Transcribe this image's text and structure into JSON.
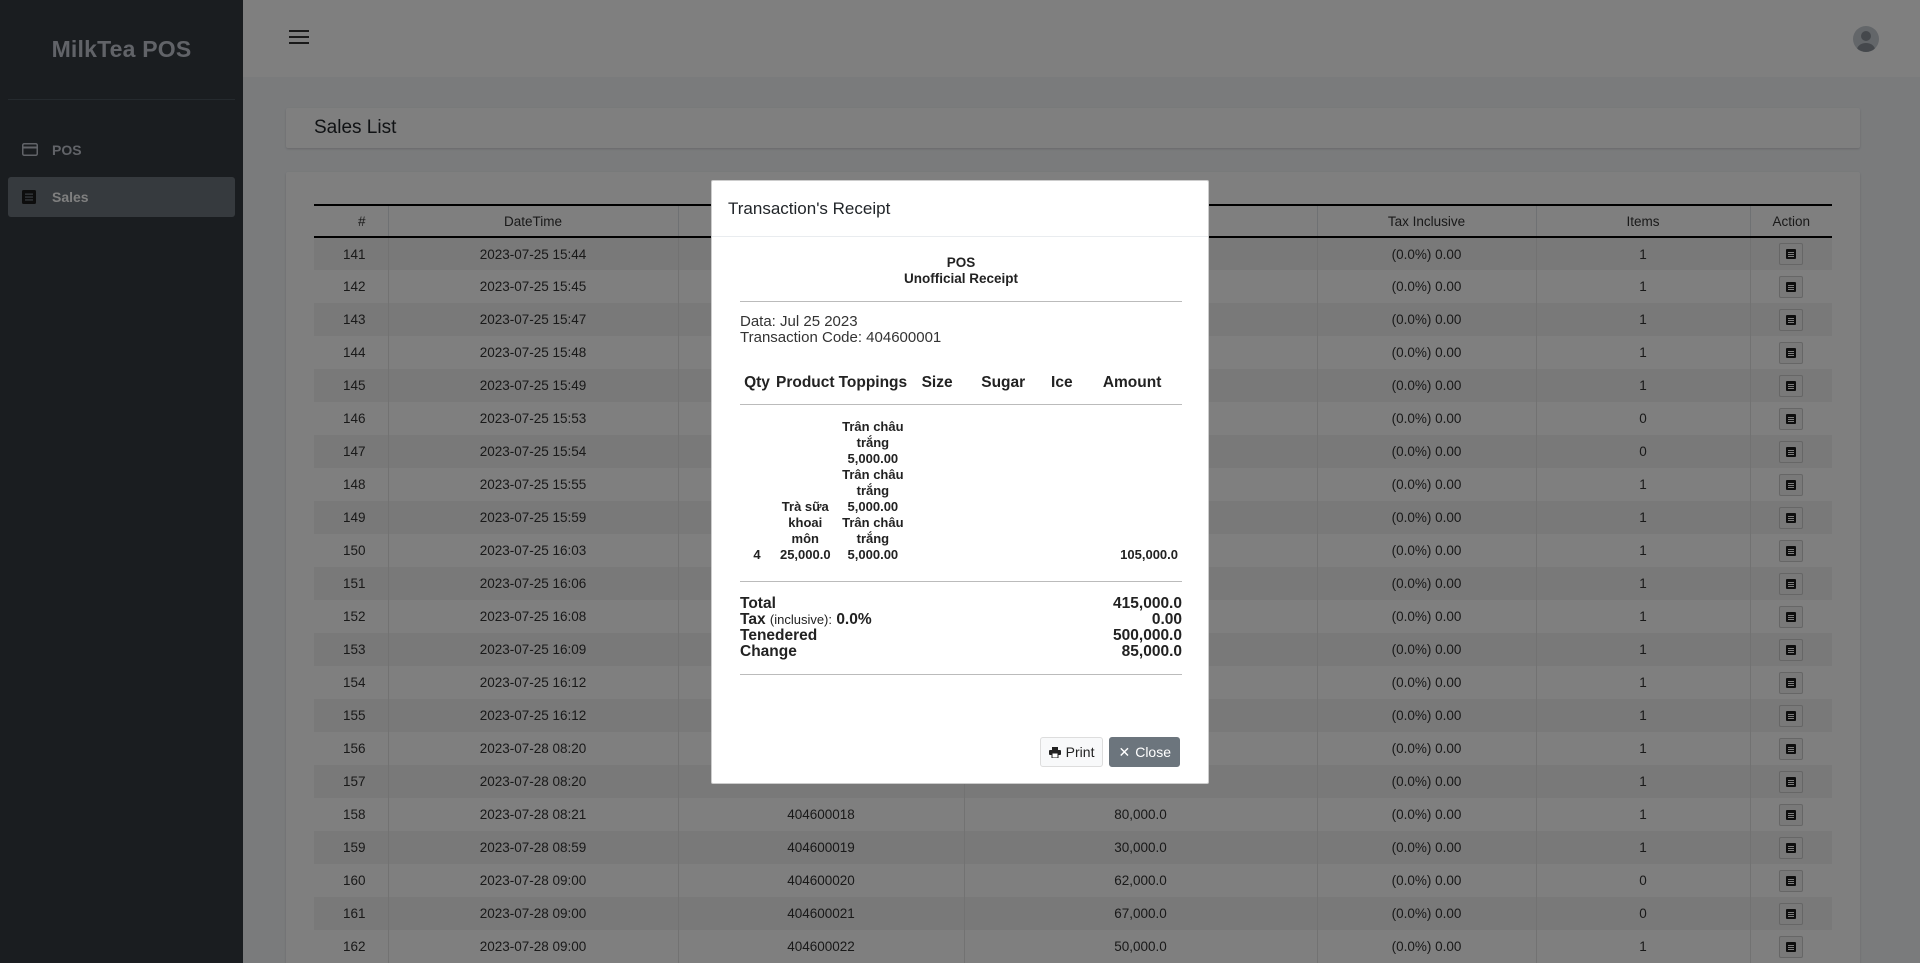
{
  "app": {
    "brand": "MilkTea POS"
  },
  "sidebar": {
    "items": [
      {
        "label": "POS",
        "icon": "card-icon"
      },
      {
        "label": "Sales",
        "icon": "list-icon"
      }
    ]
  },
  "page": {
    "title": "Sales List"
  },
  "table": {
    "headers": [
      "#",
      "DateTime",
      "",
      "",
      "Tax Inclusive",
      "Items",
      "Action"
    ],
    "rows": [
      {
        "id": "141",
        "datetime": "2023-07-25 15:44",
        "code": "",
        "amount": "",
        "tax": "(0.0%) 0.00",
        "items": "1"
      },
      {
        "id": "142",
        "datetime": "2023-07-25 15:45",
        "code": "",
        "amount": "",
        "tax": "(0.0%) 0.00",
        "items": "1"
      },
      {
        "id": "143",
        "datetime": "2023-07-25 15:47",
        "code": "",
        "amount": "",
        "tax": "(0.0%) 0.00",
        "items": "1"
      },
      {
        "id": "144",
        "datetime": "2023-07-25 15:48",
        "code": "",
        "amount": "",
        "tax": "(0.0%) 0.00",
        "items": "1"
      },
      {
        "id": "145",
        "datetime": "2023-07-25 15:49",
        "code": "",
        "amount": "",
        "tax": "(0.0%) 0.00",
        "items": "1"
      },
      {
        "id": "146",
        "datetime": "2023-07-25 15:53",
        "code": "",
        "amount": "",
        "tax": "(0.0%) 0.00",
        "items": "0"
      },
      {
        "id": "147",
        "datetime": "2023-07-25 15:54",
        "code": "",
        "amount": "",
        "tax": "(0.0%) 0.00",
        "items": "0"
      },
      {
        "id": "148",
        "datetime": "2023-07-25 15:55",
        "code": "",
        "amount": "",
        "tax": "(0.0%) 0.00",
        "items": "1"
      },
      {
        "id": "149",
        "datetime": "2023-07-25 15:59",
        "code": "",
        "amount": "",
        "tax": "(0.0%) 0.00",
        "items": "1"
      },
      {
        "id": "150",
        "datetime": "2023-07-25 16:03",
        "code": "",
        "amount": "",
        "tax": "(0.0%) 0.00",
        "items": "1"
      },
      {
        "id": "151",
        "datetime": "2023-07-25 16:06",
        "code": "",
        "amount": "",
        "tax": "(0.0%) 0.00",
        "items": "1"
      },
      {
        "id": "152",
        "datetime": "2023-07-25 16:08",
        "code": "",
        "amount": "",
        "tax": "(0.0%) 0.00",
        "items": "1"
      },
      {
        "id": "153",
        "datetime": "2023-07-25 16:09",
        "code": "",
        "amount": "",
        "tax": "(0.0%) 0.00",
        "items": "1"
      },
      {
        "id": "154",
        "datetime": "2023-07-25 16:12",
        "code": "",
        "amount": "",
        "tax": "(0.0%) 0.00",
        "items": "1"
      },
      {
        "id": "155",
        "datetime": "2023-07-25 16:12",
        "code": "",
        "amount": "",
        "tax": "(0.0%) 0.00",
        "items": "1"
      },
      {
        "id": "156",
        "datetime": "2023-07-28 08:20",
        "code": "",
        "amount": "",
        "tax": "(0.0%) 0.00",
        "items": "1"
      },
      {
        "id": "157",
        "datetime": "2023-07-28 08:20",
        "code": "",
        "amount": "",
        "tax": "(0.0%) 0.00",
        "items": "1"
      },
      {
        "id": "158",
        "datetime": "2023-07-28 08:21",
        "code": "404600018",
        "amount": "80,000.0",
        "tax": "(0.0%) 0.00",
        "items": "1"
      },
      {
        "id": "159",
        "datetime": "2023-07-28 08:59",
        "code": "404600019",
        "amount": "30,000.0",
        "tax": "(0.0%) 0.00",
        "items": "1"
      },
      {
        "id": "160",
        "datetime": "2023-07-28 09:00",
        "code": "404600020",
        "amount": "62,000.0",
        "tax": "(0.0%) 0.00",
        "items": "0"
      },
      {
        "id": "161",
        "datetime": "2023-07-28 09:00",
        "code": "404600021",
        "amount": "67,000.0",
        "tax": "(0.0%) 0.00",
        "items": "0"
      },
      {
        "id": "162",
        "datetime": "2023-07-28 09:00",
        "code": "404600022",
        "amount": "50,000.0",
        "tax": "(0.0%) 0.00",
        "items": "1"
      }
    ]
  },
  "modal": {
    "title": "Transaction's Receipt",
    "store": "POS",
    "subtitle": "Unofficial Receipt",
    "date_line": "Data: Jul 25 2023",
    "code_line": "Transaction Code: 404600001",
    "columns": [
      "Qty",
      "Product",
      "Toppings",
      "Size",
      "Sugar",
      "Ice",
      "Amount"
    ],
    "item": {
      "qty": "4",
      "product": [
        "Trà sữa",
        "khoai môn",
        "25,000.0"
      ],
      "toppings": [
        "Trân châu",
        "trắng",
        "5,000.00",
        "Trân châu",
        "trắng",
        "5,000.00",
        "Trân châu",
        "trắng",
        "5,000.00"
      ],
      "amount": "105,000.0"
    },
    "totals": {
      "total_label": "Total",
      "total_value": "415,000.0",
      "tax_label": "Tax",
      "tax_note": "(inclusive):",
      "tax_rate": "0.0%",
      "tax_value": "0.00",
      "tendered_label": "Tenedered",
      "tendered_value": "500,000.0",
      "change_label": "Change",
      "change_value": "85,000.0"
    },
    "buttons": {
      "print": "Print",
      "close": "Close"
    }
  }
}
